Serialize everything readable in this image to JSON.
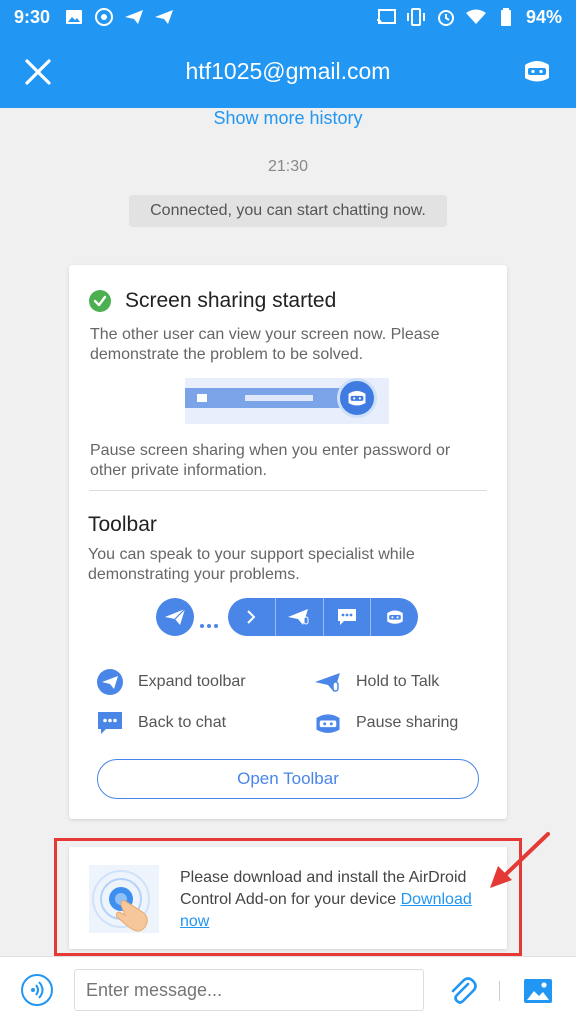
{
  "status_bar": {
    "time": "9:30",
    "battery": "94%",
    "icons": [
      "image-icon",
      "soccer-icon",
      "send-icon",
      "send-icon",
      "cast-icon",
      "vibrate-icon",
      "alarm-icon",
      "wifi-icon",
      "battery-icon"
    ]
  },
  "app_bar": {
    "title": "htf1025@gmail.com",
    "close_icon": "close-icon",
    "privacy_icon": "privacy-mask-icon"
  },
  "chat": {
    "show_more": "Show more history",
    "time": "21:30",
    "system_message": "Connected, you can start chatting now."
  },
  "screen_share_card": {
    "title": "Screen sharing started",
    "description": "The other user can view your screen now. Please demonstrate the problem to be solved.",
    "privacy_note": "Pause screen sharing when you enter password or other private information.",
    "toolbar_title": "Toolbar",
    "toolbar_description": "You can speak to your support specialist while demonstrating your problems.",
    "legend": {
      "expand": "Expand toolbar",
      "hold_to_talk": "Hold to Talk",
      "back_to_chat": "Back to chat",
      "pause_sharing": "Pause sharing"
    },
    "open_toolbar": "Open Toolbar"
  },
  "addon_card": {
    "text": "Please download and install the AirDroid Control Add-on for your device",
    "link": "Download now"
  },
  "input_bar": {
    "placeholder": "Enter message..."
  },
  "colors": {
    "primary": "#2196f3",
    "accent_blue": "#4a86e8",
    "success": "#4caf50",
    "highlight_red": "#e53935"
  }
}
